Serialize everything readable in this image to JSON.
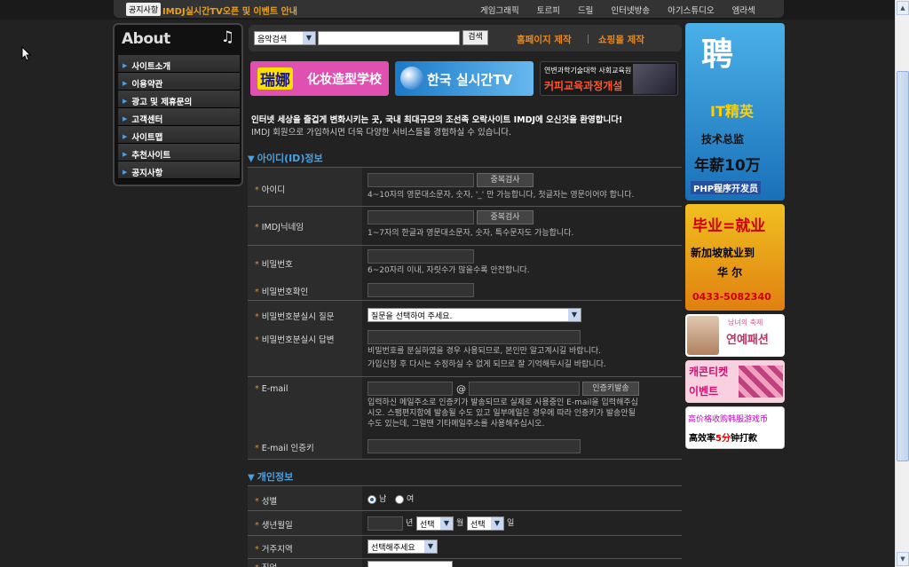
{
  "topbar": {
    "notice_badge": "공지사항",
    "notice_text": "IMDJ실시간TV오픈 및 이벤트 안내",
    "nav": [
      "게임그래픽",
      "토르피",
      "드릴",
      "인터넷방송",
      "아기스튜디오",
      "엠라섹"
    ]
  },
  "sidebar": {
    "title": "About",
    "items": [
      "사이트소개",
      "이용약관",
      "광고 및 제휴문의",
      "고객센터",
      "사이트맵",
      "추천사이트",
      "공지사항"
    ]
  },
  "search": {
    "category": "음악검색",
    "query": "",
    "button": "검색",
    "link_homepage": "홈페이지 제작",
    "link_shop": "쇼핑몰 제작"
  },
  "banners": {
    "b1_brand": "瑞娜",
    "b1_text": "化妆造型学校",
    "b2_text": "한국 실시간TV",
    "b3_line1": "연변과학기술대학 사회교육원",
    "b3_line2": "커피교육과정개설"
  },
  "welcome": {
    "line1": "인터넷 세상을 즐겁게 변화시키는 곳, 국내 최대규모의 조선족 오락사이트 IMDJ에 오신것을 환영합니다!",
    "line2": "IMDJ 회원으로 가입하시면 더욱 다양한 서비스들을 경험하실 수 있습니다."
  },
  "section_id": {
    "title": "아이디(ID)정보",
    "id_label": "아이디",
    "id_button": "중복검사",
    "id_hint": "4~10자의 영문대소문자, 숫자, '_' 만 가능합니다, 첫글자는 영문이어야 합니다.",
    "nick_label": "IMDJ닉네임",
    "nick_button": "중복검사",
    "nick_hint": "1~7자의 한글과 영문대소문자, 숫자, 특수문자도 가능합니다.",
    "pw_label": "비밀번호",
    "pw_hint": "6~20자리 이내, 자릿수가 많을수록 안전합니다.",
    "pw_confirm_label": "비밀번호확인",
    "pw_q_label": "비밀번호분실시 질문",
    "pw_q_select": "질문을 선택하여 주세요.",
    "pw_a_label": "비밀번호분실시 답변",
    "pw_a_hint1": "비밀번호를 분실하였을 경우 사용되므로, 본인만 알고계시길 바랍니다.",
    "pw_a_hint2": "가입신청 후 다시는 수정하실 수 없게 되므로 잘 기억해두시길 바랍니다.",
    "email_label": "E-mail",
    "email_at": "@",
    "email_button": "인증키발송",
    "email_hint1": "입력하신 메일주소로 인증키가 발송되므로 실제로 사용중인 E-mail을 입력해주십",
    "email_hint2": "시오. 스팸편지함에 발송될 수도 있고 일부메일은 경우에 따라 인증키가 발송안될",
    "email_hint3": "수도 있는데, 그럴땐 기타메일주소를 사용해주십시오.",
    "email_auth_label": "E-mail 인증키"
  },
  "section_personal": {
    "title": "개인정보",
    "gender_label": "성별",
    "gender_male": "남",
    "gender_female": "여",
    "birth_label": "생년월일",
    "birth_year_unit": "년",
    "birth_month_select": "선택",
    "birth_month_unit": "월",
    "birth_day_select": "선택",
    "birth_day_unit": "일",
    "region_label": "거주지역",
    "region_select": "선택해주세요",
    "job_label": "직업"
  },
  "ads": {
    "ad1_big": "聘",
    "ad1_it": "IT精英",
    "ad1_l1": "技术总监",
    "ad1_l2": "年薪10万",
    "ad1_l3": "PHP程序开发员",
    "ad2_t1": "毕业=就业",
    "ad2_t2": "新加坡就业到",
    "ad2_t3": "华 尔",
    "ad2_t4": "0433-5082340",
    "ad3_t1": "남녀의 축제",
    "ad3_t2": "연예패션",
    "ad4_t1": "캐콘티켓",
    "ad4_t2": "이벤트",
    "ad5_t1": "高价格收购韩服游戏币",
    "ad5_t2a": "高效率",
    "ad5_t2b": "5分",
    "ad5_t2c": "钟打款"
  }
}
